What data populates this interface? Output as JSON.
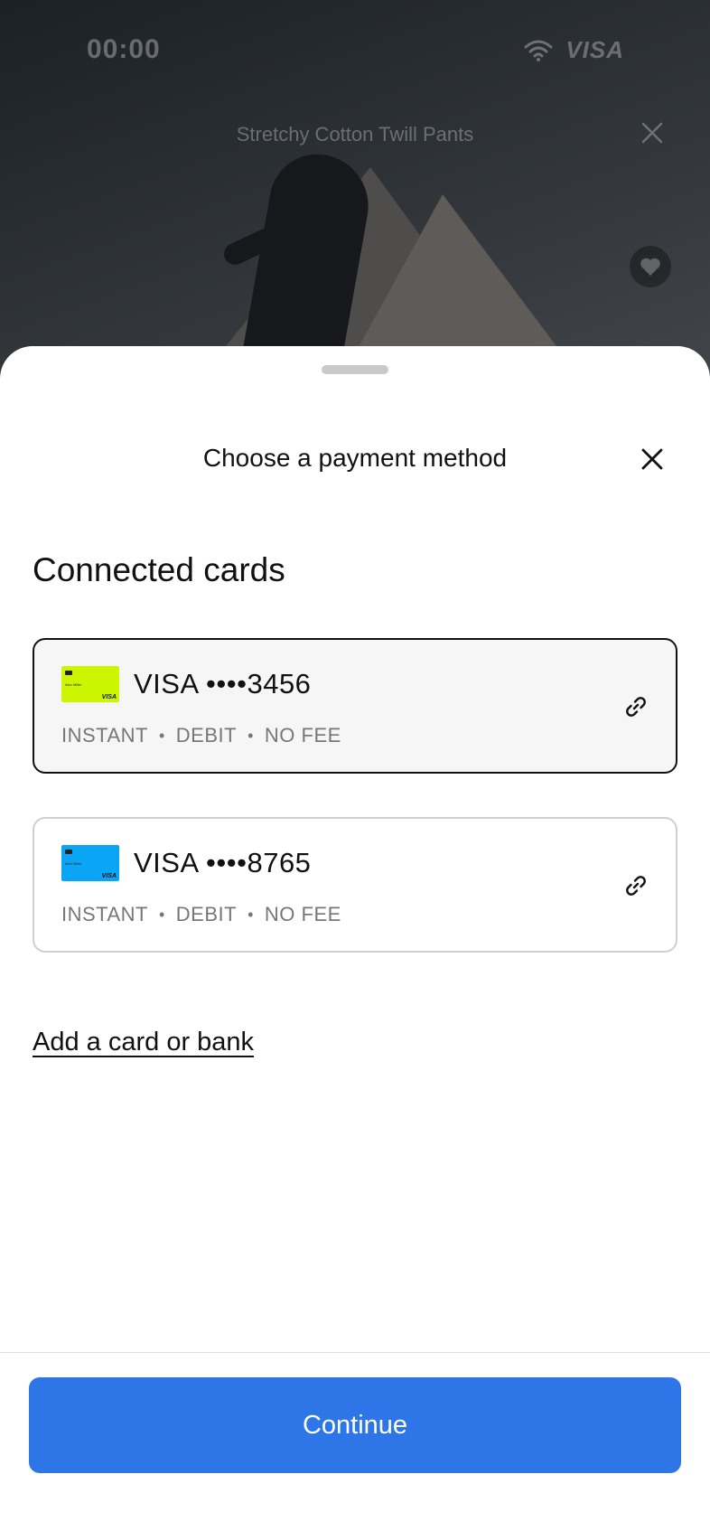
{
  "status_bar": {
    "time": "00:00",
    "brand": "VISA",
    "wifi_icon": "wifi-icon"
  },
  "background": {
    "product_title": "Stretchy Cotton Twill Pants",
    "close_icon": "close-icon",
    "favorite_icon": "heart-icon"
  },
  "sheet": {
    "title": "Choose a payment method",
    "close_icon": "close-icon",
    "section_heading": "Connected cards",
    "cards": [
      {
        "name": "VISA ••••3456",
        "holder": "Alex Miller",
        "thumb_brand": "VISA",
        "meta": [
          "INSTANT",
          "DEBIT",
          "NO FEE"
        ],
        "thumb_color": "#ccf500",
        "selected": true,
        "icon": "link-icon"
      },
      {
        "name": "VISA ••••8765",
        "holder": "Alex Miller",
        "thumb_brand": "VISA",
        "meta": [
          "INSTANT",
          "DEBIT",
          "NO FEE"
        ],
        "thumb_color": "#0aa6f5",
        "selected": false,
        "icon": "link-icon"
      }
    ],
    "add_link": "Add a card or bank",
    "continue_label": "Continue"
  },
  "colors": {
    "accent": "#2e76e8",
    "selected_border": "#111111",
    "selected_bg": "#f6f6f6"
  }
}
